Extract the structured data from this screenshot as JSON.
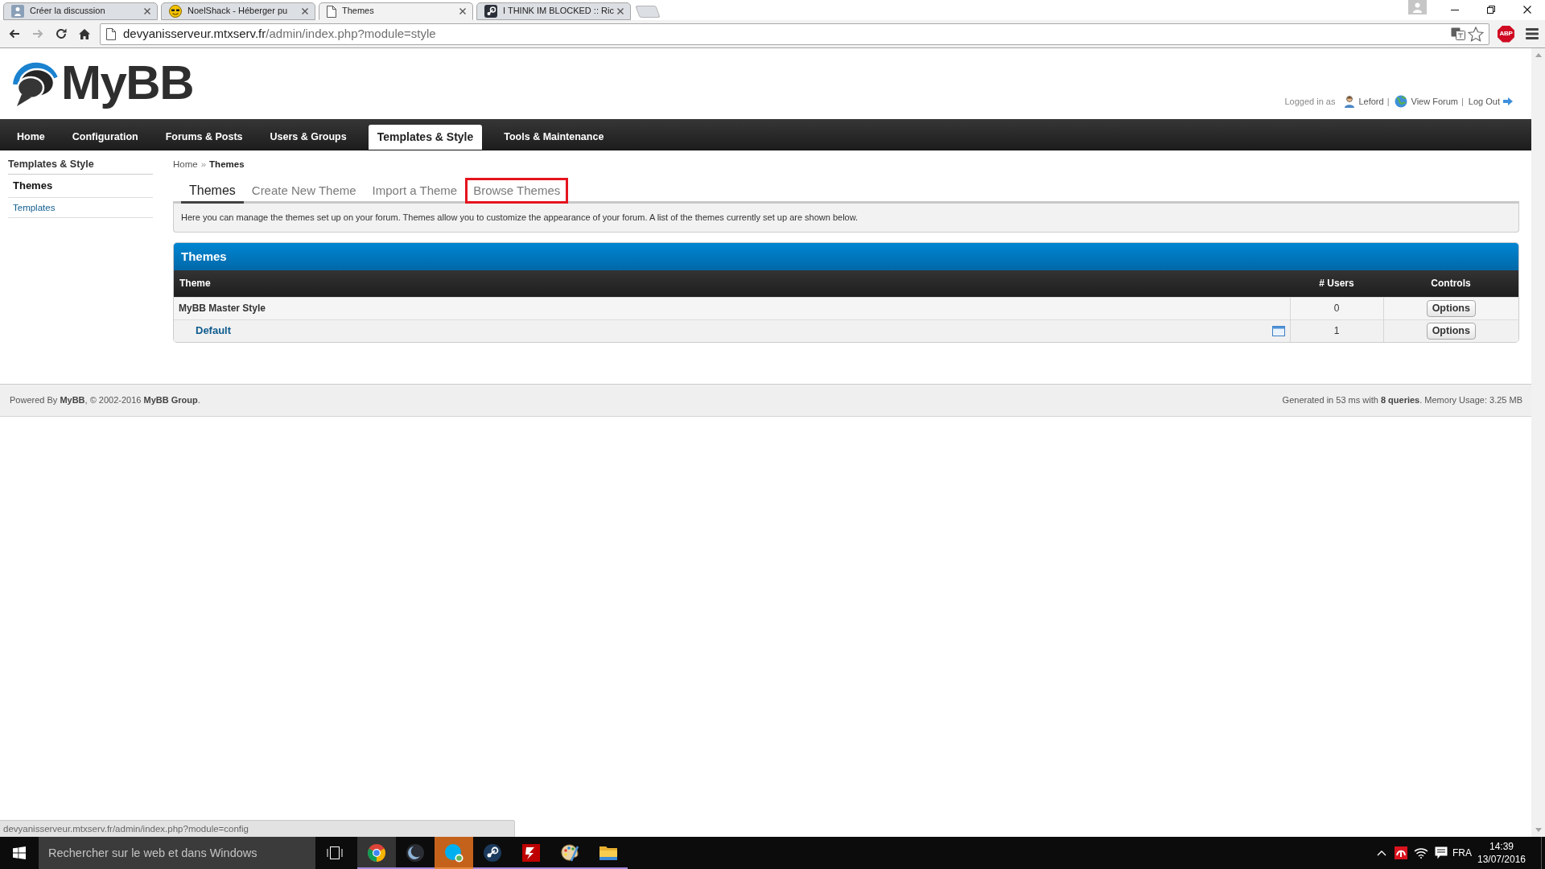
{
  "browser": {
    "tabs": [
      {
        "title": "Créer la discussion",
        "selected": false
      },
      {
        "title": "NoelShack - Héberger pu",
        "selected": false
      },
      {
        "title": "Themes",
        "selected": true
      },
      {
        "title": "I THINK IM BLOCKED :: Ric",
        "selected": false
      }
    ],
    "forward_disabled": true,
    "url": {
      "host": "devyanisserveur.mtxserv.fr",
      "path": "/admin/index.php?module=style"
    },
    "extension_badge": "ABP"
  },
  "header": {
    "logo_text": "MyBB",
    "logged_in_label": "Logged in as",
    "links": [
      {
        "label": "Leford",
        "separator": "|"
      },
      {
        "label": "View Forum",
        "separator": "|"
      },
      {
        "label": "Log Out"
      }
    ]
  },
  "nav": [
    {
      "label": "Home",
      "selected": false
    },
    {
      "label": "Configuration",
      "selected": false
    },
    {
      "label": "Forums & Posts",
      "selected": false
    },
    {
      "label": "Users & Groups",
      "selected": false
    },
    {
      "label": "Templates & Style",
      "selected": true
    },
    {
      "label": "Tools & Maintenance",
      "selected": false
    }
  ],
  "sidebar": {
    "title": "Templates & Style",
    "items": [
      {
        "label": "Themes",
        "selected": true
      },
      {
        "label": "Templates",
        "selected": false
      }
    ]
  },
  "breadcrumb": {
    "items": [
      "Home",
      "Themes"
    ],
    "separator": "»"
  },
  "subtabs": [
    {
      "label": "Themes",
      "selected": true,
      "highlighted": false
    },
    {
      "label": "Create New Theme",
      "selected": false,
      "highlighted": false
    },
    {
      "label": "Import a Theme",
      "selected": false,
      "highlighted": false
    },
    {
      "label": "Browse Themes",
      "selected": false,
      "highlighted": true
    }
  ],
  "description": "Here you can manage the themes set up on your forum. Themes allow you to customize the appearance of your forum. A list of the themes currently set up are shown below.",
  "themes_table": {
    "title": "Themes",
    "columns": [
      "Theme",
      "# Users",
      "Controls"
    ],
    "rows": [
      {
        "name": "MyBB Master Style",
        "users": "0",
        "action": "Options",
        "is_default": false,
        "children": [
          {
            "name": "Default",
            "users": "1",
            "action": "Options",
            "is_default": true
          }
        ]
      }
    ]
  },
  "footer": {
    "credits": "Powered By **MyBB**, © 2002-2016 **MyBB Group**.",
    "stats": "Generated in 53 ms with **8 queries**. Memory Usage: 3.25 MB"
  },
  "status_bar": {
    "url": "devyanisserveur.mtxserv.fr/admin/index.php?module=config"
  },
  "taskbar": {
    "search": {
      "placeholder": "Rechercher sur le web et dans Windows"
    },
    "apps": [
      {
        "running": true,
        "selected": true,
        "attention": false
      },
      {
        "running": true,
        "selected": false,
        "attention": false
      },
      {
        "running": true,
        "selected": false,
        "attention": true
      },
      {
        "running": true,
        "selected": false,
        "attention": false
      },
      {
        "running": true,
        "selected": false,
        "attention": false
      },
      {
        "running": true,
        "selected": false,
        "attention": false
      },
      {
        "running": true,
        "selected": false,
        "attention": false
      }
    ],
    "tray": {
      "language": "FRA",
      "time": "14:39",
      "date": "13/07/2016"
    }
  }
}
